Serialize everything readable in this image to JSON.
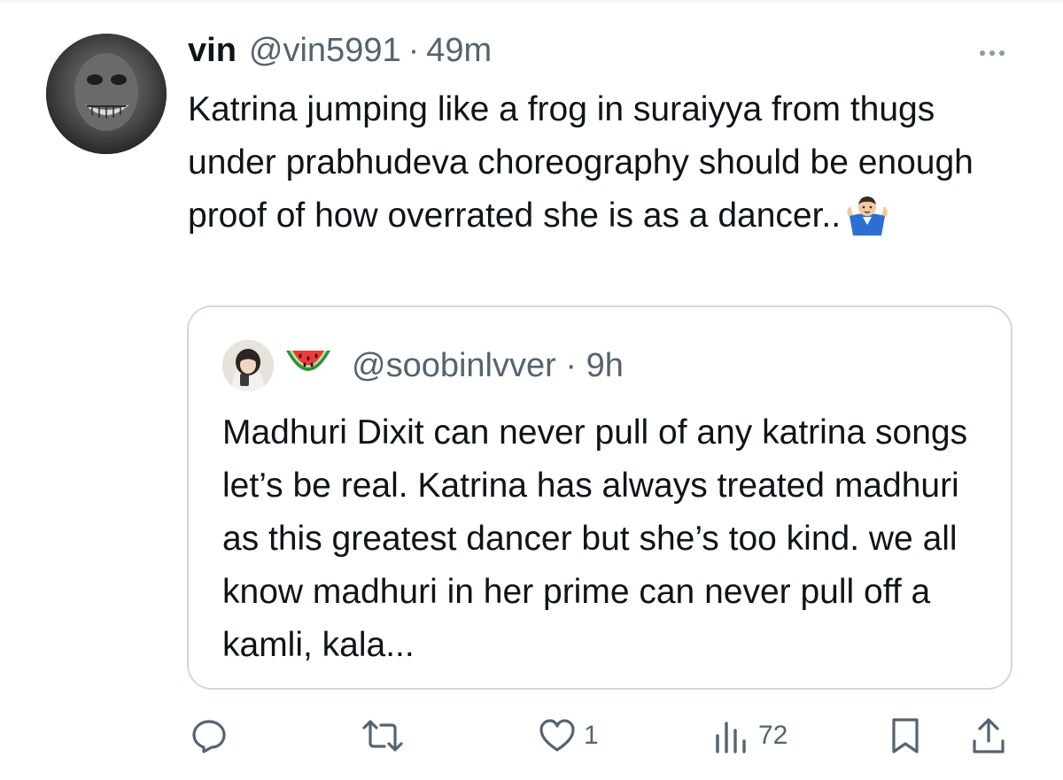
{
  "tweet": {
    "author_name": "vin",
    "author_handle": "@vin5991",
    "separator": "·",
    "time": "49m",
    "text": "Katrina jumping like a frog in suraiyya from thugs under prabhudeva choreography should be enough proof of how overrated she is as a dancer..",
    "emoji": "shrugging-man-emoji",
    "more_icon": "more-horizontal-icon"
  },
  "quote": {
    "avatar_emoji": "watermelon-emoji",
    "handle": "@soobinlvver",
    "separator": "·",
    "time": "9h",
    "text": "Madhuri Dixit can never pull of any katrina songs let’s be real. Katrina has always treated madhuri as this greatest dancer but she’s too kind. we all know madhuri in her prime can never pull off a kamli, kala..."
  },
  "actions": {
    "reply_icon": "reply-icon",
    "retweet_icon": "retweet-icon",
    "like_icon": "heart-icon",
    "like_count": "1",
    "views_icon": "views-icon",
    "views_count": "72",
    "bookmark_icon": "bookmark-icon",
    "share_icon": "share-icon"
  },
  "colors": {
    "text": "#0f1419",
    "secondary": "#536471",
    "border": "#cfd9de"
  }
}
